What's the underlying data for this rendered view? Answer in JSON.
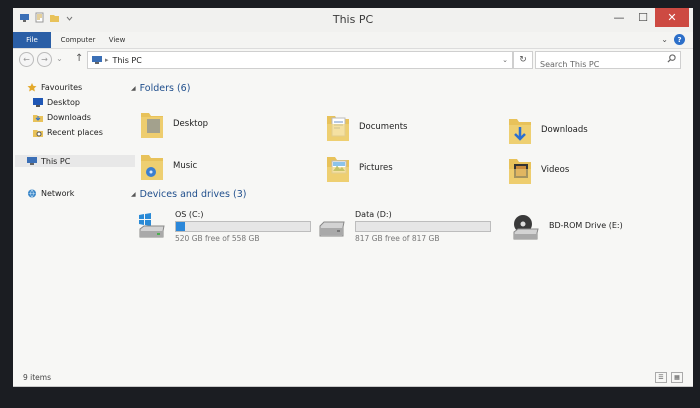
{
  "window": {
    "title": "This PC"
  },
  "window_controls": {
    "minimize": "—",
    "maximize": "☐",
    "close": "✕"
  },
  "ribbon": {
    "tabs": [
      {
        "label": "File"
      },
      {
        "label": "Computer"
      },
      {
        "label": "View"
      }
    ],
    "collapse_glyph": "⌄",
    "help_glyph": "?"
  },
  "address": {
    "back_glyph": "←",
    "forward_glyph": "→",
    "up_glyph": "↑",
    "separator": "▸",
    "path": "This PC",
    "dropdown_glyph": "⌄",
    "refresh_glyph": "↻"
  },
  "search": {
    "placeholder": "Search This PC",
    "icon": "search-icon"
  },
  "nav": {
    "items": [
      {
        "label": "Favourites",
        "icon": "star-icon"
      },
      {
        "label": "Desktop",
        "icon": "desktop-icon"
      },
      {
        "label": "Downloads",
        "icon": "downloads-icon"
      },
      {
        "label": "Recent places",
        "icon": "recent-places-icon"
      },
      {
        "label": "This PC",
        "icon": "computer-icon"
      },
      {
        "label": "Network",
        "icon": "network-icon"
      }
    ]
  },
  "groups": {
    "folders": {
      "label": "Folders (6)",
      "items": [
        {
          "label": "Desktop",
          "icon": "desktop-folder-icon"
        },
        {
          "label": "Documents",
          "icon": "documents-folder-icon"
        },
        {
          "label": "Downloads",
          "icon": "downloads-folder-icon"
        },
        {
          "label": "Music",
          "icon": "music-folder-icon"
        },
        {
          "label": "Pictures",
          "icon": "pictures-folder-icon"
        },
        {
          "label": "Videos",
          "icon": "videos-folder-icon"
        }
      ]
    },
    "drives": {
      "label": "Devices and drives (3)",
      "items": [
        {
          "label": "OS (C:)",
          "free_text": "520 GB free of 558 GB",
          "used_fraction": 0.068,
          "icon": "windows-drive-icon"
        },
        {
          "label": "Data (D:)",
          "free_text": "817 GB free of 817 GB",
          "used_fraction": 0.0,
          "icon": "hard-drive-icon"
        },
        {
          "label": "BD-ROM Drive (E:)",
          "icon": "bd-rom-drive-icon"
        }
      ]
    }
  },
  "status": {
    "items_text": "9 items"
  },
  "colors": {
    "accent": "#2a5ea6",
    "close": "#cd4a42",
    "progress": "#2b87d9",
    "folder": "#e8c25a"
  }
}
